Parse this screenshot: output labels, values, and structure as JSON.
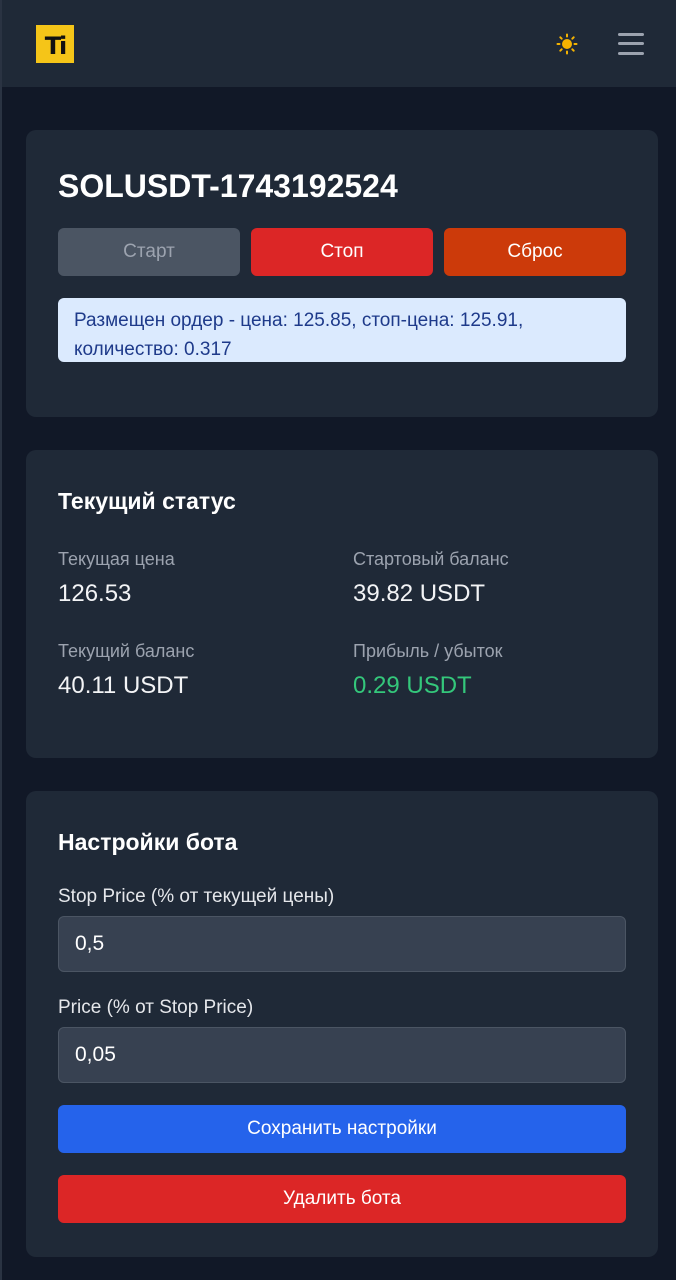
{
  "header": {
    "logo_text": "Ti",
    "logo_color": "#f5c518",
    "theme_icon": "sun-icon",
    "menu_icon": "hamburger-menu-icon"
  },
  "bot": {
    "name": "SOLUSDT-1743192524",
    "buttons": {
      "start": "Старт",
      "stop": "Стоп",
      "reset": "Сброс"
    },
    "message": "Размещен ордер - цена: 125.85, стоп-цена: 125.91, количество: 0.317"
  },
  "status": {
    "title": "Текущий статус",
    "current_price_label": "Текущая цена",
    "current_price": "126.53",
    "start_balance_label": "Стартовый баланс",
    "start_balance": "39.82 USDT",
    "current_balance_label": "Текущий баланс",
    "current_balance": "40.11 USDT",
    "pnl_label": "Прибыль / убыток",
    "pnl": "0.29 USDT",
    "pnl_color": "#34c77b"
  },
  "settings": {
    "title": "Настройки бота",
    "stop_price_label": "Stop Price (% от текущей цены)",
    "stop_price_value": "0,5",
    "price_label": "Price (% от Stop Price)",
    "price_value": "0,05",
    "save_label": "Сохранить настройки",
    "delete_label": "Удалить бота"
  },
  "colors": {
    "background": "#111827",
    "card": "#1f2937",
    "primary": "#2563eb",
    "danger": "#dc2626",
    "warning": "#cc3a0a",
    "info_bg": "#dbeafe",
    "info_text": "#1e3a8a"
  }
}
